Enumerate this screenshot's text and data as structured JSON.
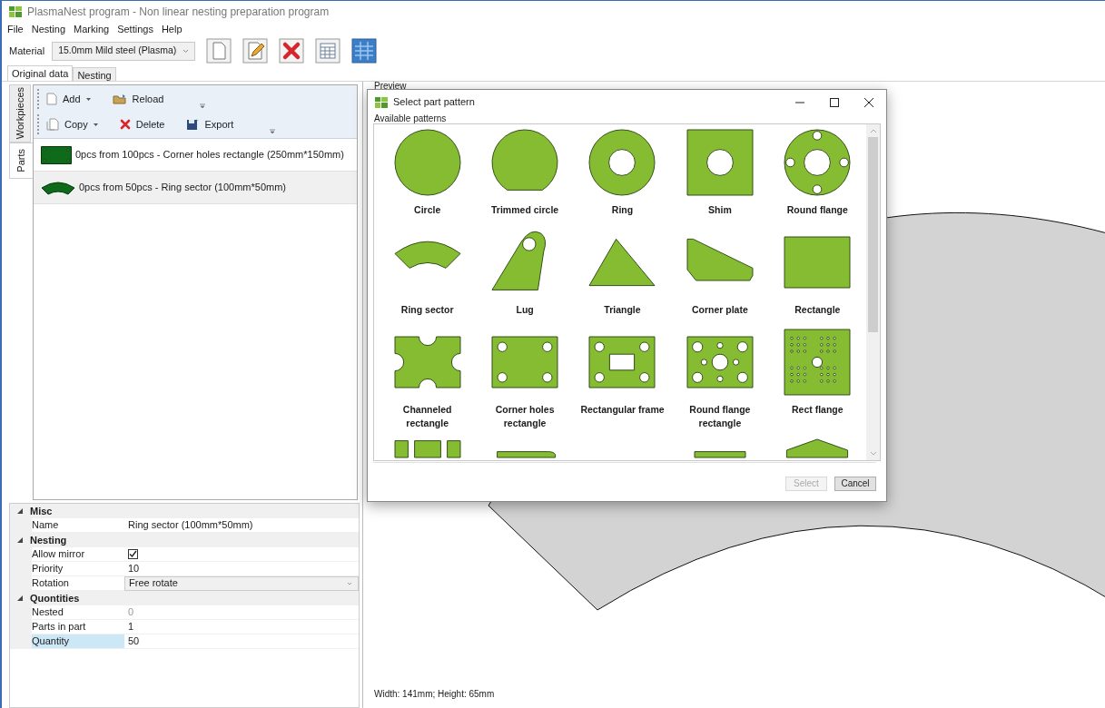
{
  "window": {
    "title": "PlasmaNest program - Non linear nesting preparation program"
  },
  "menu": [
    "File",
    "Nesting",
    "Marking",
    "Settings",
    "Help"
  ],
  "material": {
    "label": "Material",
    "value": "15.0mm Mild steel (Plasma)"
  },
  "toolbar": [
    {
      "kind": "new"
    },
    {
      "kind": "edit"
    },
    {
      "kind": "delete"
    },
    {
      "kind": "table"
    },
    {
      "kind": "grid"
    }
  ],
  "tabs": [
    {
      "label": "Original data",
      "selected": true
    },
    {
      "label": "Nesting",
      "selected": false
    }
  ],
  "side_tabs": [
    {
      "label": "Workpieces",
      "selected": false
    },
    {
      "label": "Parts",
      "selected": true
    }
  ],
  "parts_toolbar": [
    [
      {
        "kind": "add",
        "label": "Add",
        "caret": true
      },
      {
        "kind": "reload",
        "label": "Reload",
        "caret": false
      }
    ],
    [
      {
        "kind": "copy",
        "label": "Copy",
        "caret": true
      },
      {
        "kind": "delete",
        "label": "Delete",
        "caret": false
      },
      {
        "kind": "export",
        "label": "Export",
        "caret": false
      }
    ]
  ],
  "parts": [
    {
      "kind": "corner-holes",
      "text": "0pcs from 100pcs - Corner holes rectangle (250mm*150mm)",
      "selected": false
    },
    {
      "kind": "ring-sector",
      "text": "0pcs from 50pcs - Ring sector (100mm*50mm)",
      "selected": true
    }
  ],
  "properties": [
    {
      "name": "Misc",
      "expanded": true,
      "rows": [
        {
          "label": "Name",
          "kind": "text",
          "value": "Ring sector (100mm*50mm)",
          "selected": false
        }
      ]
    },
    {
      "name": "Nesting",
      "expanded": true,
      "rows": [
        {
          "label": "Allow mirror",
          "kind": "checkbox",
          "checked": true,
          "selected": false
        },
        {
          "label": "Priority",
          "kind": "text",
          "value": "10",
          "selected": false
        },
        {
          "label": "Rotation",
          "kind": "dropdown",
          "value": "Free rotate",
          "selected": false
        }
      ]
    },
    {
      "name": "Quontities",
      "expanded": true,
      "rows": [
        {
          "label": "Nested",
          "kind": "readonly",
          "value": "0",
          "selected": false
        },
        {
          "label": "Parts in part",
          "kind": "text",
          "value": "1",
          "selected": false
        },
        {
          "label": "Quantity",
          "kind": "text",
          "value": "50",
          "selected": true
        }
      ]
    }
  ],
  "preview": {
    "title": "Preview",
    "size_text": "Width: 141mm; Height: 65mm"
  },
  "dialog": {
    "title": "Select part pattern",
    "group": "Available patterns",
    "patterns": [
      {
        "kind": "circle",
        "name": "Circle"
      },
      {
        "kind": "trimmed-circle",
        "name": "Trimmed circle"
      },
      {
        "kind": "ring",
        "name": "Ring"
      },
      {
        "kind": "shim",
        "name": "Shim"
      },
      {
        "kind": "round-flange",
        "name": "Round flange"
      },
      {
        "kind": "ring-sector",
        "name": "Ring sector"
      },
      {
        "kind": "lug",
        "name": "Lug"
      },
      {
        "kind": "triangle",
        "name": "Triangle"
      },
      {
        "kind": "corner-plate",
        "name": "Corner plate"
      },
      {
        "kind": "rectangle",
        "name": "Rectangle"
      },
      {
        "kind": "channeled",
        "name": "Channeled rectangle"
      },
      {
        "kind": "corner-holes",
        "name": "Corner holes rectangle"
      },
      {
        "kind": "rect-frame",
        "name": "Rectangular frame"
      },
      {
        "kind": "round-flange-rect",
        "name": "Round flange rectangle"
      },
      {
        "kind": "rect-flange",
        "name": "Rect flange"
      },
      {
        "kind": "slots"
      },
      {
        "kind": "rounded-top"
      },
      {
        "kind": "blank"
      },
      {
        "kind": "flat-top"
      },
      {
        "kind": "gable"
      }
    ],
    "buttons": [
      {
        "label": "Select",
        "disabled": true
      },
      {
        "label": "Cancel",
        "disabled": false
      }
    ]
  }
}
